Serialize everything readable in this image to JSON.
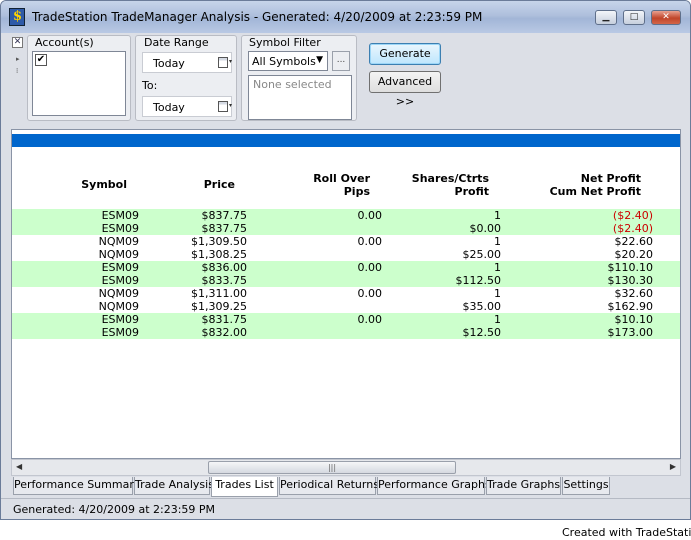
{
  "window": {
    "title": "TradeStation TradeManager Analysis - Generated: 4/20/2009 at 2:23:59 PM"
  },
  "toolbar": {
    "accounts_label": "Account(s)",
    "account_check": "✔",
    "date_range_label": "Date Range",
    "date_from": "Today",
    "to_label": "To:",
    "date_to": "Today",
    "symbol_filter_label": "Symbol Filter",
    "symbol_filter_value": "All Symbols",
    "ellipsis_label": "...",
    "none_selected": "None selected",
    "generate_label": "Generate",
    "advanced_label": "Advanced >>"
  },
  "table": {
    "headers": {
      "symbol": "Symbol",
      "price": "Price",
      "rollover_1": "Roll Over",
      "rollover_2": "Pips",
      "shares_1": "Shares/Ctrts",
      "shares_2": "Profit",
      "net_1": "Net Profit",
      "net_2": "Cum Net Profit"
    },
    "rows": [
      {
        "symbol": "ESM09",
        "price": "$837.75",
        "pips": "0.00",
        "shares": "1",
        "net": "($2.40)",
        "net_color": "#cc0000",
        "green": true
      },
      {
        "symbol": "ESM09",
        "price": "$837.75",
        "pips": "",
        "shares": "$0.00",
        "net": "($2.40)",
        "net_color": "#cc0000",
        "green": true
      },
      {
        "symbol": "NQM09",
        "price": "$1,309.50",
        "pips": "0.00",
        "shares": "1",
        "net": "$22.60",
        "net_color": "#000000",
        "green": false
      },
      {
        "symbol": "NQM09",
        "price": "$1,308.25",
        "pips": "",
        "shares": "$25.00",
        "net": "$20.20",
        "net_color": "#000000",
        "green": false
      },
      {
        "symbol": "ESM09",
        "price": "$836.00",
        "pips": "0.00",
        "shares": "1",
        "net": "$110.10",
        "net_color": "#000000",
        "green": true
      },
      {
        "symbol": "ESM09",
        "price": "$833.75",
        "pips": "",
        "shares": "$112.50",
        "net": "$130.30",
        "net_color": "#000000",
        "green": true
      },
      {
        "symbol": "NQM09",
        "price": "$1,311.00",
        "pips": "0.00",
        "shares": "1",
        "net": "$32.60",
        "net_color": "#000000",
        "green": false
      },
      {
        "symbol": "NQM09",
        "price": "$1,309.25",
        "pips": "",
        "shares": "$35.00",
        "net": "$162.90",
        "net_color": "#000000",
        "green": false
      },
      {
        "symbol": "ESM09",
        "price": "$831.75",
        "pips": "0.00",
        "shares": "1",
        "net": "$10.10",
        "net_color": "#000000",
        "green": true
      },
      {
        "symbol": "ESM09",
        "price": "$832.00",
        "pips": "",
        "shares": "$12.50",
        "net": "$173.00",
        "net_color": "#000000",
        "green": true
      }
    ]
  },
  "tabs": [
    {
      "label": "Performance Summary",
      "active": false
    },
    {
      "label": "Trade Analysis",
      "active": false
    },
    {
      "label": "Trades List",
      "active": true
    },
    {
      "label": "Periodical Returns",
      "active": false
    },
    {
      "label": "Performance Graphs",
      "active": false
    },
    {
      "label": "Trade Graphs",
      "active": false
    },
    {
      "label": "Settings",
      "active": false
    }
  ],
  "status": "Generated: 4/20/2009 at 2:23:59 PM",
  "credit": "Created with TradeStation",
  "colors": {
    "accent_bar": "#0066cc",
    "row_green": "#ccffcc",
    "negative": "#cc0000"
  }
}
